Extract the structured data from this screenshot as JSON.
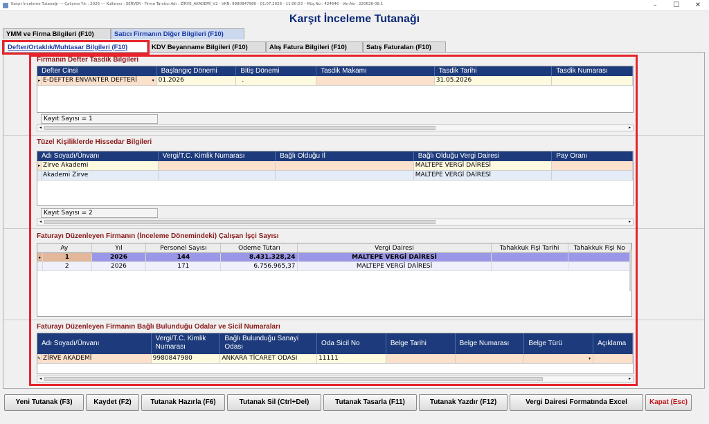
{
  "window": {
    "titlebar_text": "Karşıt İnceleme Tutanağı  ---  Çalışma Yılı : 2026  ---  Kullanıcı : SERVER - Firma Tanıtıcı Adı : ZİRVE_AKADEMİ_V2 - VKN: 9980847980 - 01.07.2026 - 11:00:53 - Müş.No : 424646 - Ver.No : 220626-08.1",
    "minimize": "–",
    "maximize": "☐",
    "close": "✕"
  },
  "page_title": "Karşıt İnceleme Tutanağı",
  "tabs_row1": [
    "YMM ve Firma Bilgileri (F10)",
    "Satıcı Firmanın Diğer Bilgileri (F10)"
  ],
  "tabs_row2": [
    "Defter/Ortaklık/Muhtasar Bilgileri (F10)",
    "KDV Beyanname Bilgileri (F10)",
    "Alış Fatura Bilgileri (F10)",
    "Satış Faturaları (F10)"
  ],
  "section1": {
    "title": "Firmanın Defter Tasdik Bilgileri",
    "headers": [
      "Defter Cinsi",
      "Başlangıç Dönemi",
      "Bitiş Dönemi",
      "Tasdik Makamı",
      "Tasdik Tarihi",
      "Tasdik Numarası"
    ],
    "rows": [
      [
        "E-DEFTER ENVANTER DEFTERİ",
        "01.2026",
        ".",
        "",
        "31.05.2026",
        ""
      ]
    ],
    "row_marker": "▸",
    "dropdown_icon": "▾",
    "record_count": "Kayıt Sayısı = 1"
  },
  "section2": {
    "title": "Tüzel Kişiliklerde Hissedar Bilgileri",
    "headers": [
      "Adı Soyadı/Ünvanı",
      "Vergi/T.C. Kimlik Numarası",
      "Bağlı Olduğu İl",
      "Bağlı Olduğu Vergi Dairesi",
      "Pay Oranı"
    ],
    "rows": [
      [
        "Zirve Akademi",
        "",
        "",
        "MALTEPE VERGİ DAİRESİ",
        ""
      ],
      [
        "Akademi Zirve",
        "",
        "",
        "MALTEPE VERGİ DAİRESİ",
        ""
      ]
    ],
    "row_marker": "▸",
    "record_count": "Kayıt Sayısı = 2"
  },
  "section3": {
    "title": "Faturayı Düzenleyen Firmanın (İnceleme Dönemindeki) Çalışan İşçi Sayısı",
    "headers": [
      "Ay",
      "Yıl",
      "Personel Sayısı",
      "Odeme Tutarı",
      "Vergi Dairesi",
      "Tahakkuk Fişi Tarihi",
      "Tahakkuk Fişi No"
    ],
    "rows": [
      [
        "1",
        "2026",
        "144",
        "8.431.328,24",
        "MALTEPE VERGİ DAİRESİ",
        "",
        ""
      ],
      [
        "2",
        "2026",
        "171",
        "6.756.965,37",
        "MALTEPE VERGİ DAİRESİ",
        "",
        ""
      ]
    ],
    "row_marker": "▸"
  },
  "section4": {
    "title": "Faturayı Düzenleyen Firmanın Bağlı Bulunduğu Odalar ve Sicil Numaraları",
    "headers": [
      "Adı Soyadı/Ünvanı",
      "Vergi/T.C. Kimlik Numarası",
      "Bağlı Bulunduğu Sanayi Odası",
      "Oda Sicil No",
      "Belge Tarihi",
      "Belge Numarası",
      "Belge Türü",
      "Açıklama"
    ],
    "rows": [
      [
        "ZİRVE AKADEMİ",
        "9980847980",
        "ANKARA TİCARET ODASI",
        "11111",
        "",
        "",
        "",
        ""
      ]
    ],
    "row_marker": "✎",
    "dropdown_icon": "▾"
  },
  "scroll_left": "◂",
  "scroll_right": "▸",
  "buttons": [
    "Yeni Tutanak (F3)",
    "Kaydet (F2)",
    "Tutanak Hazırla (F6)",
    "Tutanak Sil (Ctrl+Del)",
    "Tutanak Tasarla (F11)",
    "Tutanak Yazdır (F12)",
    "Vergi Dairesi Formatında Excel",
    "Kapat (Esc)"
  ],
  "colors": {
    "title_blue": "#0b2a78",
    "section_red": "#8b1a1a",
    "grid_header": "#1d3b7c",
    "highlight_red": "#e8232c"
  }
}
